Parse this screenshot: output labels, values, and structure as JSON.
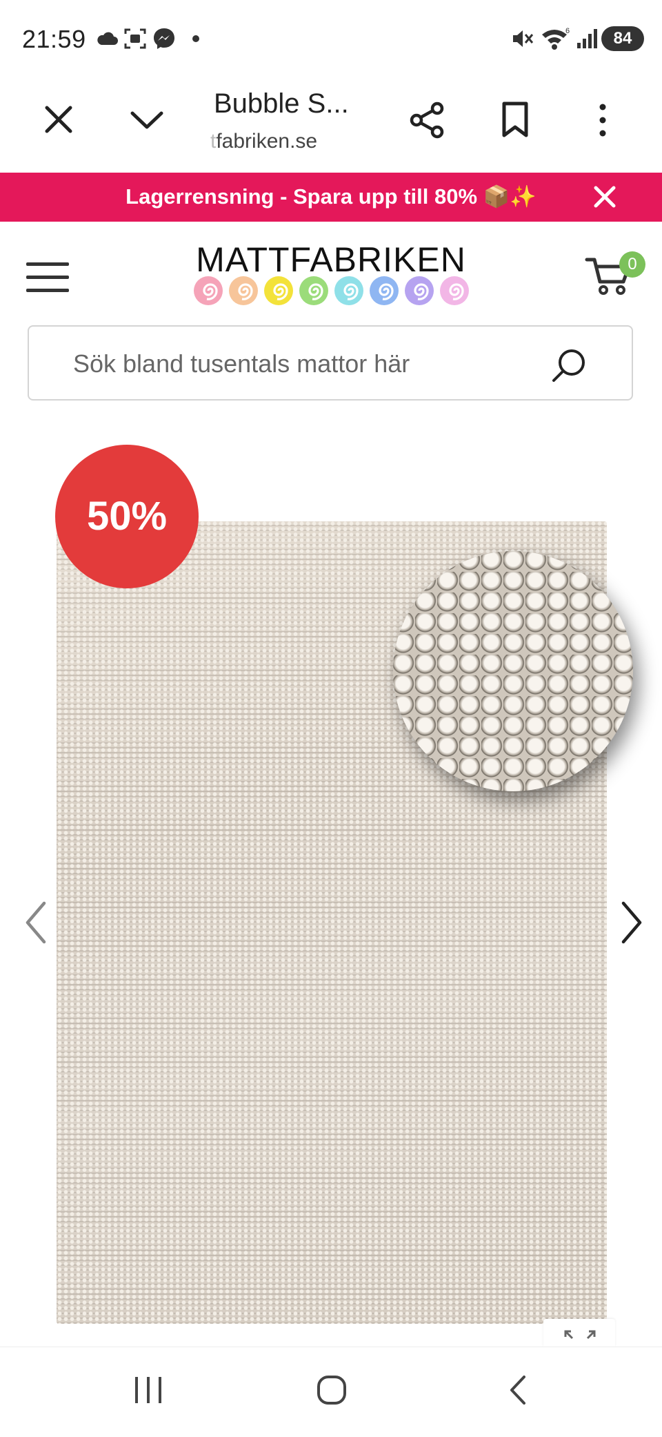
{
  "status_bar": {
    "time": "21:59",
    "battery": "84",
    "left_icons": [
      "cloud-icon",
      "screenshot-icon",
      "messenger-icon",
      "dot-icon"
    ],
    "right_icons": [
      "mute-icon",
      "wifi-icon",
      "signal-icon",
      "battery-icon"
    ]
  },
  "tab_bar": {
    "title": "Bubble S...",
    "url_faded": "t",
    "url": "fabriken.se",
    "icons": [
      "close-icon",
      "chevron-down-icon",
      "share-icon",
      "bookmark-icon",
      "more-vert-icon"
    ]
  },
  "promo": {
    "text": "Lagerrensning - Spara upp till 80% 📦✨"
  },
  "header": {
    "logo": "MATTFABRIKEN",
    "swirl_colors": [
      "#f5a3b8",
      "#f7c59a",
      "#f3e23a",
      "#9bdc7a",
      "#8fe0e8",
      "#8fb6f2",
      "#b6a3f0",
      "#f2b6e6"
    ],
    "cart_count": "0"
  },
  "search": {
    "placeholder": "Sök bland tusentals mattor här"
  },
  "product": {
    "discount_badge": "50%"
  },
  "colors": {
    "promo": "#e4185a",
    "badge": "#e33b3b",
    "cart_badge": "#7cc15a"
  }
}
